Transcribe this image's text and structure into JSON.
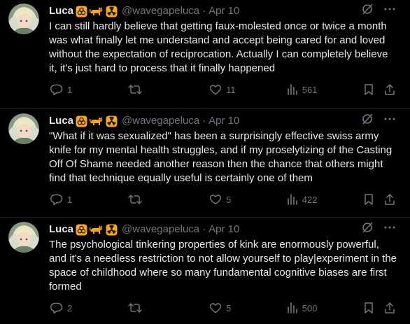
{
  "tweets": [
    {
      "name": "Luca",
      "badges": [
        "biohazard-badge",
        "cat-badge",
        "radioactive-badge"
      ],
      "handle": "@wavegapeluca",
      "separator": "·",
      "time": "Apr 10",
      "text": "I can still hardly believe that getting faux-molested once or twice a month was what finally let me understand and accept being cared for and loved without the expectation of reciprocation. Actually I can completely believe it, it's just hard to process that it finally happened",
      "replies": "1",
      "reposts": "",
      "likes": "11",
      "views": "561"
    },
    {
      "name": "Luca",
      "badges": [
        "biohazard-badge",
        "cat-badge",
        "radioactive-badge"
      ],
      "handle": "@wavegapeluca",
      "separator": "·",
      "time": "Apr 10",
      "text": "\"What if it was sexualized\" has been a surprisingly effective swiss army knife for my mental health struggles, and if my proselytizing of the Casting Off Of Shame needed another reason then the chance that others might find that technique equally useful is certainly one of them",
      "replies": "1",
      "reposts": "",
      "likes": "5",
      "views": "422"
    },
    {
      "name": "Luca",
      "badges": [
        "biohazard-badge",
        "cat-badge",
        "radioactive-badge"
      ],
      "handle": "@wavegapeluca",
      "separator": "·",
      "time": "Apr 10",
      "text": "The psychological tinkering properties of kink are enormously powerful, and it's a needless restriction to not allow yourself to play|experiment in the space of childhood where so many fundamental cognitive biases are first formed",
      "replies": "2",
      "reposts": "",
      "likes": "5",
      "views": "500"
    }
  ],
  "colors": {
    "background": "#000000",
    "text": "#e7e9ea",
    "muted": "#71767b",
    "badge": "#f5a623",
    "divider": "#1f2326"
  }
}
